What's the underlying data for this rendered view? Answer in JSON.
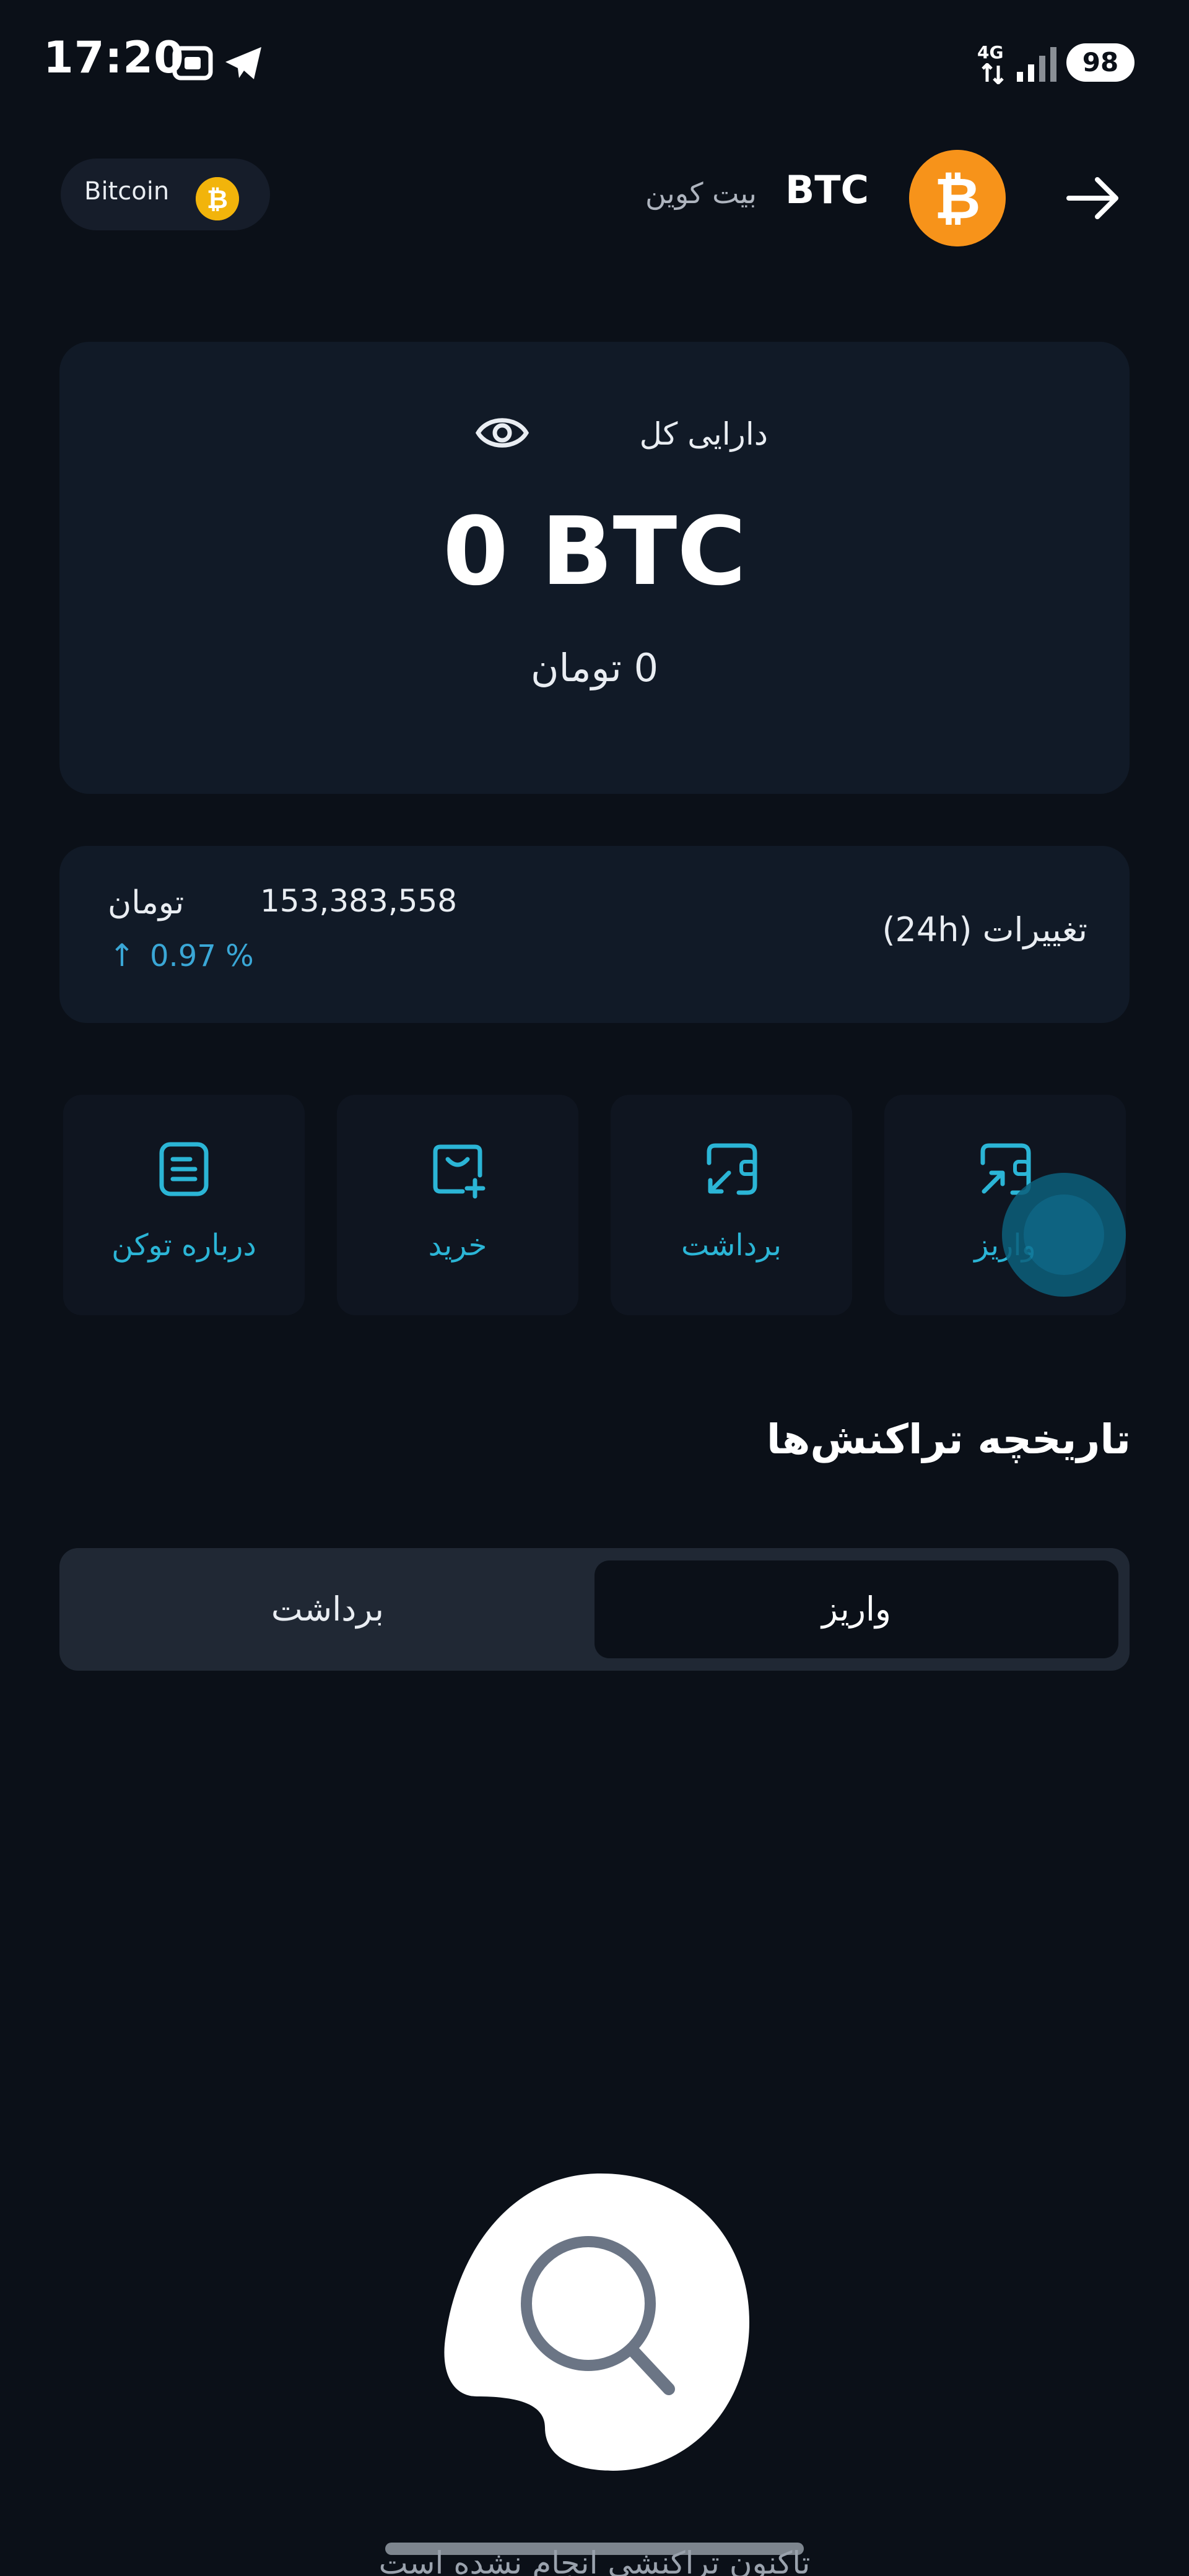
{
  "status_bar": {
    "time": "17:20",
    "network": "4G",
    "battery": "98",
    "icons": [
      "screen-record-icon",
      "telegram-icon",
      "signal-icon"
    ]
  },
  "header": {
    "chip_label": "Bitcoin",
    "coin_symbol": "BTC",
    "coin_name_fa": "بیت کوین",
    "back_icon": "arrow-right-icon",
    "coin_color": "#f7931a"
  },
  "balance": {
    "title": "دارایی کل",
    "amount": "0 BTC",
    "fiat": "0 تومان"
  },
  "changes": {
    "label": "تغییرات (24h)",
    "price": "153,383,558",
    "unit": "تومان",
    "arrow": "↑",
    "percent": "0.97 %",
    "accent": "#3aa7d6"
  },
  "actions": [
    {
      "label": "واریز",
      "icon": "deposit-icon"
    },
    {
      "label": "برداشت",
      "icon": "withdraw-icon"
    },
    {
      "label": "خرید",
      "icon": "buy-icon"
    },
    {
      "label": "درباره توکن",
      "icon": "document-icon"
    }
  ],
  "history": {
    "title": "تاریخچه تراکنش‌ها",
    "tab_deposit": "واریز",
    "tab_withdraw": "برداشت",
    "empty_text": "تاکنون تراکنشی انجام نشده است"
  }
}
